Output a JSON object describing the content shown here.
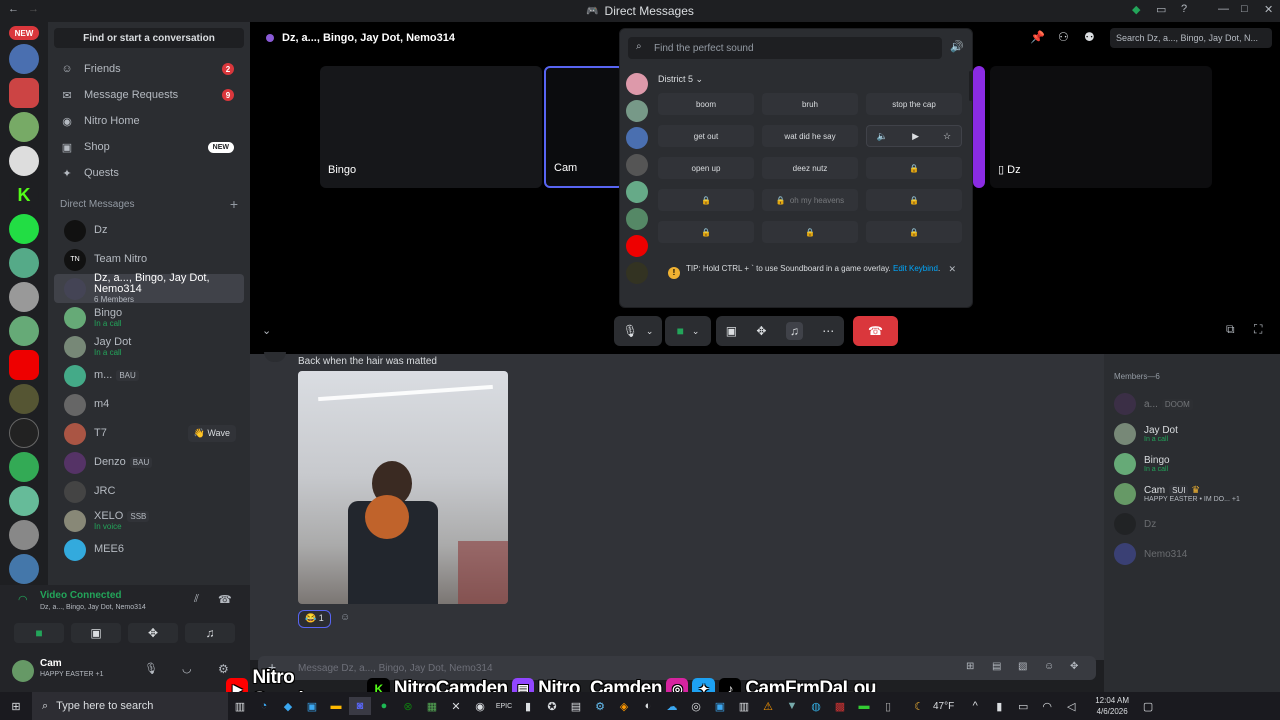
{
  "window": {
    "title": "Direct Messages"
  },
  "sidebar": {
    "find_label": "Find or start a conversation",
    "nav": [
      {
        "label": "Friends",
        "badge": "2"
      },
      {
        "label": "Message Requests",
        "badge": "9"
      },
      {
        "label": "Nitro Home"
      },
      {
        "label": "Shop",
        "tag": "NEW"
      },
      {
        "label": "Quests"
      }
    ],
    "dm_header": "Direct Messages",
    "dms": [
      {
        "name": "Dz",
        "sub": ""
      },
      {
        "name": "Team Nitro",
        "sub": ""
      },
      {
        "name": "Dz, a..., Bingo, Jay Dot, Nemo314",
        "sub": "6 Members"
      },
      {
        "name": "Bingo",
        "sub": "In a call"
      },
      {
        "name": "Jay Dot",
        "sub": "In a call"
      },
      {
        "name": "m...",
        "sub": "",
        "tag": "BAU"
      },
      {
        "name": "m4",
        "sub": ""
      },
      {
        "name": "T7",
        "sub": "",
        "action": "Wave"
      },
      {
        "name": "Denzo",
        "sub": "",
        "tag": "BAU"
      },
      {
        "name": "JRC",
        "sub": ""
      },
      {
        "name": "XELO",
        "sub": "In voice",
        "tag": "SSB"
      },
      {
        "name": "MEE6",
        "sub": ""
      }
    ],
    "rail_new": "NEW"
  },
  "voice": {
    "status": "Video Connected",
    "channel": "Dz, a..., Bingo, Jay Dot, Nemo314"
  },
  "user": {
    "name": "Cam",
    "status": "HAPPY EASTER",
    "extra": "+1"
  },
  "call": {
    "header": "Dz, a..., Bingo, Jay Dot, Nemo314",
    "tiles": [
      {
        "label": "Bingo"
      },
      {
        "label": "Cam"
      },
      {
        "label": "Dz"
      }
    ],
    "search_placeholder": "Search Dz, a..., Bingo, Jay Dot, N..."
  },
  "soundboard": {
    "placeholder": "Find the perfect sound",
    "server": "District 5",
    "sounds": [
      {
        "label": "boom",
        "locked": false
      },
      {
        "label": "bruh",
        "locked": false
      },
      {
        "label": "stop the cap",
        "locked": false
      },
      {
        "label": "get out",
        "locked": false
      },
      {
        "label": "wat did he say",
        "locked": false
      },
      {
        "label": "",
        "locked": false,
        "preview": true
      },
      {
        "label": "open up",
        "locked": false
      },
      {
        "label": "deez nutz",
        "locked": false
      },
      {
        "label": "",
        "locked": true
      },
      {
        "label": "",
        "locked": true
      },
      {
        "label": "oh my heavens",
        "locked": true
      },
      {
        "label": "",
        "locked": true
      },
      {
        "label": "",
        "locked": true
      },
      {
        "label": "",
        "locked": true
      },
      {
        "label": "",
        "locked": true
      }
    ],
    "tip_text": "TIP: Hold CTRL + ` to use Soundboard in a game overlay.",
    "tip_link": "Edit Keybind"
  },
  "chat": {
    "message": "Back when the hair was matted",
    "reaction_count": "1",
    "input_placeholder": "Message Dz, a..., Bingo, Jay Dot, Nemo314"
  },
  "members": {
    "header": "Members—6",
    "list": [
      {
        "name": "a...",
        "sub": "",
        "tag": "DOOM"
      },
      {
        "name": "Jay Dot",
        "sub": "In a call"
      },
      {
        "name": "Bingo",
        "sub": "In a call"
      },
      {
        "name": "Cam",
        "sub": "HAPPY EASTER • IM DO...",
        "tag": "SUI",
        "extra": "+1"
      },
      {
        "name": "Dz",
        "sub": ""
      },
      {
        "name": "Nemo314",
        "sub": ""
      }
    ]
  },
  "overlay": {
    "youtube": "Nitro Camden",
    "kick": "NitroCamden",
    "twitch": "Nitro_Camden",
    "social": "CamFrmDaLou"
  },
  "taskbar": {
    "search_placeholder": "Type here to search",
    "weather": "47°F",
    "time": "12:04 AM",
    "date": "4/6/2026"
  },
  "colors": {
    "accent": "#5865f2",
    "danger": "#da373c",
    "online": "#23a55a"
  }
}
